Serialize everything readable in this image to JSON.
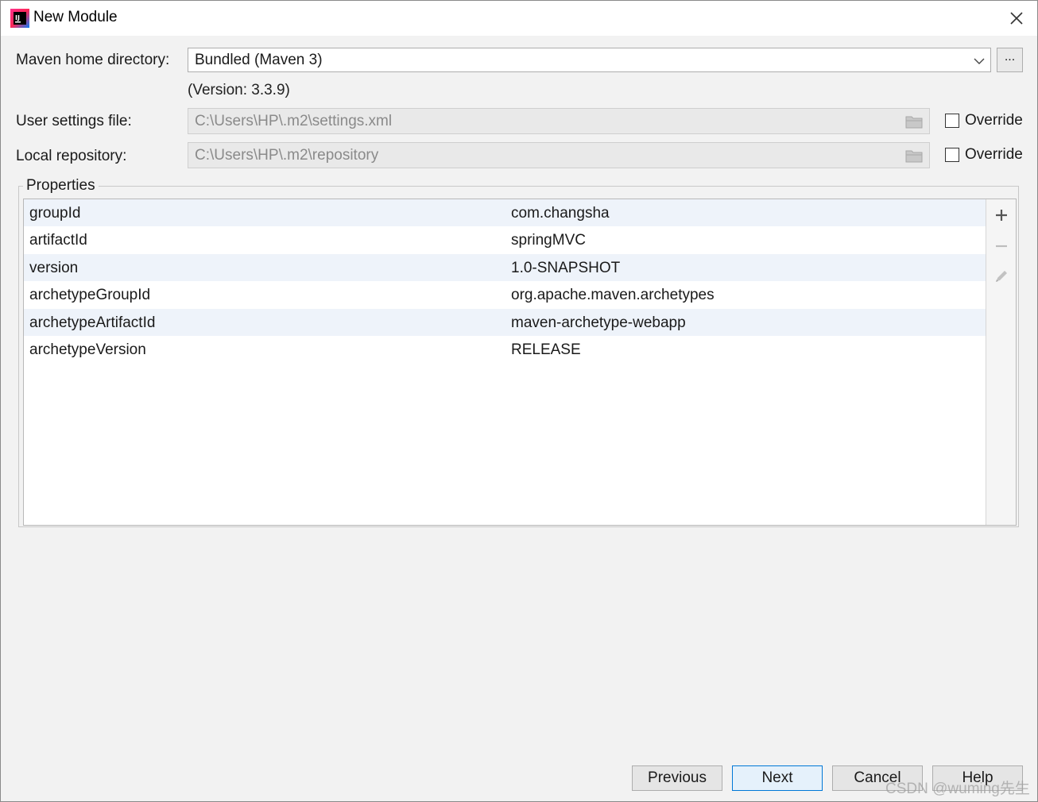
{
  "window": {
    "title": "New Module"
  },
  "maven": {
    "home_label": "Maven home directory:",
    "home_value": "Bundled (Maven 3)",
    "browse_label": "...",
    "version_text": "(Version: 3.3.9)",
    "settings_label": "User settings file:",
    "settings_value": "C:\\Users\\HP\\.m2\\settings.xml",
    "repo_label": "Local repository:",
    "repo_value": "C:\\Users\\HP\\.m2\\repository",
    "override_label": "Override",
    "settings_override_checked": false,
    "repo_override_checked": false
  },
  "properties": {
    "legend": "Properties",
    "rows": [
      {
        "key": "groupId",
        "value": "com.changsha"
      },
      {
        "key": "artifactId",
        "value": "springMVC"
      },
      {
        "key": "version",
        "value": "1.0-SNAPSHOT"
      },
      {
        "key": "archetypeGroupId",
        "value": "org.apache.maven.archetypes"
      },
      {
        "key": "archetypeArtifactId",
        "value": "maven-archetype-webapp"
      },
      {
        "key": "archetypeVersion",
        "value": "RELEASE"
      }
    ]
  },
  "buttons": {
    "previous": "Previous",
    "next": "Next",
    "cancel": "Cancel",
    "help": "Help"
  },
  "watermark": "CSDN @wuming先生",
  "colors": {
    "accent": "#0078d7",
    "row_alt": "#eef3fa"
  },
  "icons": [
    "intellij-app-icon",
    "close-icon",
    "chevron-down-icon",
    "folder-icon",
    "plus-icon",
    "minus-icon",
    "edit-icon"
  ]
}
